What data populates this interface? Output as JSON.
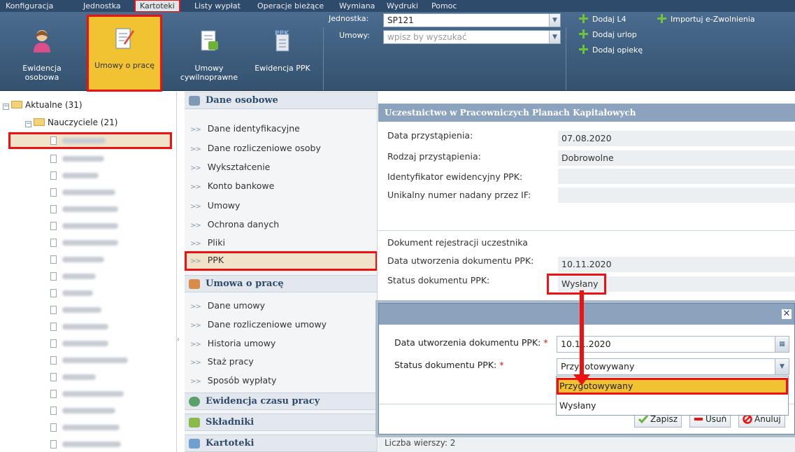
{
  "menu": {
    "items": [
      "Konfiguracja",
      "Jednostka",
      "Kartoteki",
      "Listy wypłat",
      "Operacje bieżące",
      "Wymiana",
      "Wydruki",
      "Pomoc"
    ],
    "active": "Kartoteki"
  },
  "toolbar": {
    "buttons": [
      {
        "label": "Ewidencja\nosobowa",
        "icon": "person-icon"
      },
      {
        "label": "Umowy o pracę",
        "icon": "contract-edit-icon"
      },
      {
        "label": "Umowy\ncywilnoprawne",
        "icon": "contract-icon"
      },
      {
        "label": "Ewidencja PPK",
        "icon": "ppk-icon"
      }
    ],
    "unit_label": "Jednostka:",
    "unit_value": "SP121",
    "contracts_label": "Umowy:",
    "contracts_placeholder": "wpisz by wyszukać",
    "links": [
      "Dodaj L4",
      "Dodaj urlop",
      "Dodaj opiekę",
      "Importuj e-Zwolnienia"
    ]
  },
  "tree": {
    "root_label": "Aktualne (31)",
    "group_label": "Nauczyciele (21)"
  },
  "nav": {
    "sections": [
      {
        "title": "Dane osobowe",
        "items": [
          "Dane identyfikacyjne",
          "Dane rozliczeniowe osoby",
          "Wykształcenie",
          "Konto bankowe",
          "Umowy",
          "Ochrona danych",
          "Pliki",
          "PPK"
        ]
      },
      {
        "title": "Umowa o pracę",
        "items": [
          "Dane umowy",
          "Dane rozliczeniowe umowy",
          "Historia umowy",
          "Staż pracy",
          "Sposób wypłaty"
        ]
      },
      {
        "title": "Ewidencja czasu pracy",
        "items": []
      },
      {
        "title": "Składniki",
        "items": []
      },
      {
        "title": "Kartoteki",
        "items": []
      }
    ],
    "selected": "PPK"
  },
  "panel": {
    "title": "Uczestnictwo w Pracowniczych Planach Kapitałowych",
    "rows": [
      {
        "label": "Data przystąpienia:",
        "value": "07.08.2020"
      },
      {
        "label": "Rodzaj przystąpienia:",
        "value": "Dobrowolne"
      },
      {
        "label": "Identyfikator ewidencyjny PPK:",
        "value": ""
      },
      {
        "label": "Unikalny numer nadany przez IF:",
        "value": ""
      }
    ],
    "doc_heading": "Dokument rejestracji uczestnika",
    "doc_rows": [
      {
        "label": "Data utworzenia dokumentu PPK:",
        "value": "10.11.2020"
      },
      {
        "label": "Status dokumentu PPK:",
        "value": "Wysłany"
      }
    ],
    "row_count": "Liczba wierszy: 2"
  },
  "dialog": {
    "date_label": "Data utworzenia dokumentu PPK:",
    "date_value": "10.11.2020",
    "status_label": "Status dokumentu PPK:",
    "status_value": "Przygotowywany",
    "required_mark": "*",
    "close_glyph": "✕",
    "options": [
      "Przygotowywany",
      "Wysłany"
    ],
    "buttons": {
      "save": "Zapisz",
      "delete": "Usuń",
      "cancel": "Anuluj"
    }
  },
  "colors": {
    "highlight_border": "#e11111",
    "selection": "#f1c232",
    "header": "#2f4b6b"
  }
}
